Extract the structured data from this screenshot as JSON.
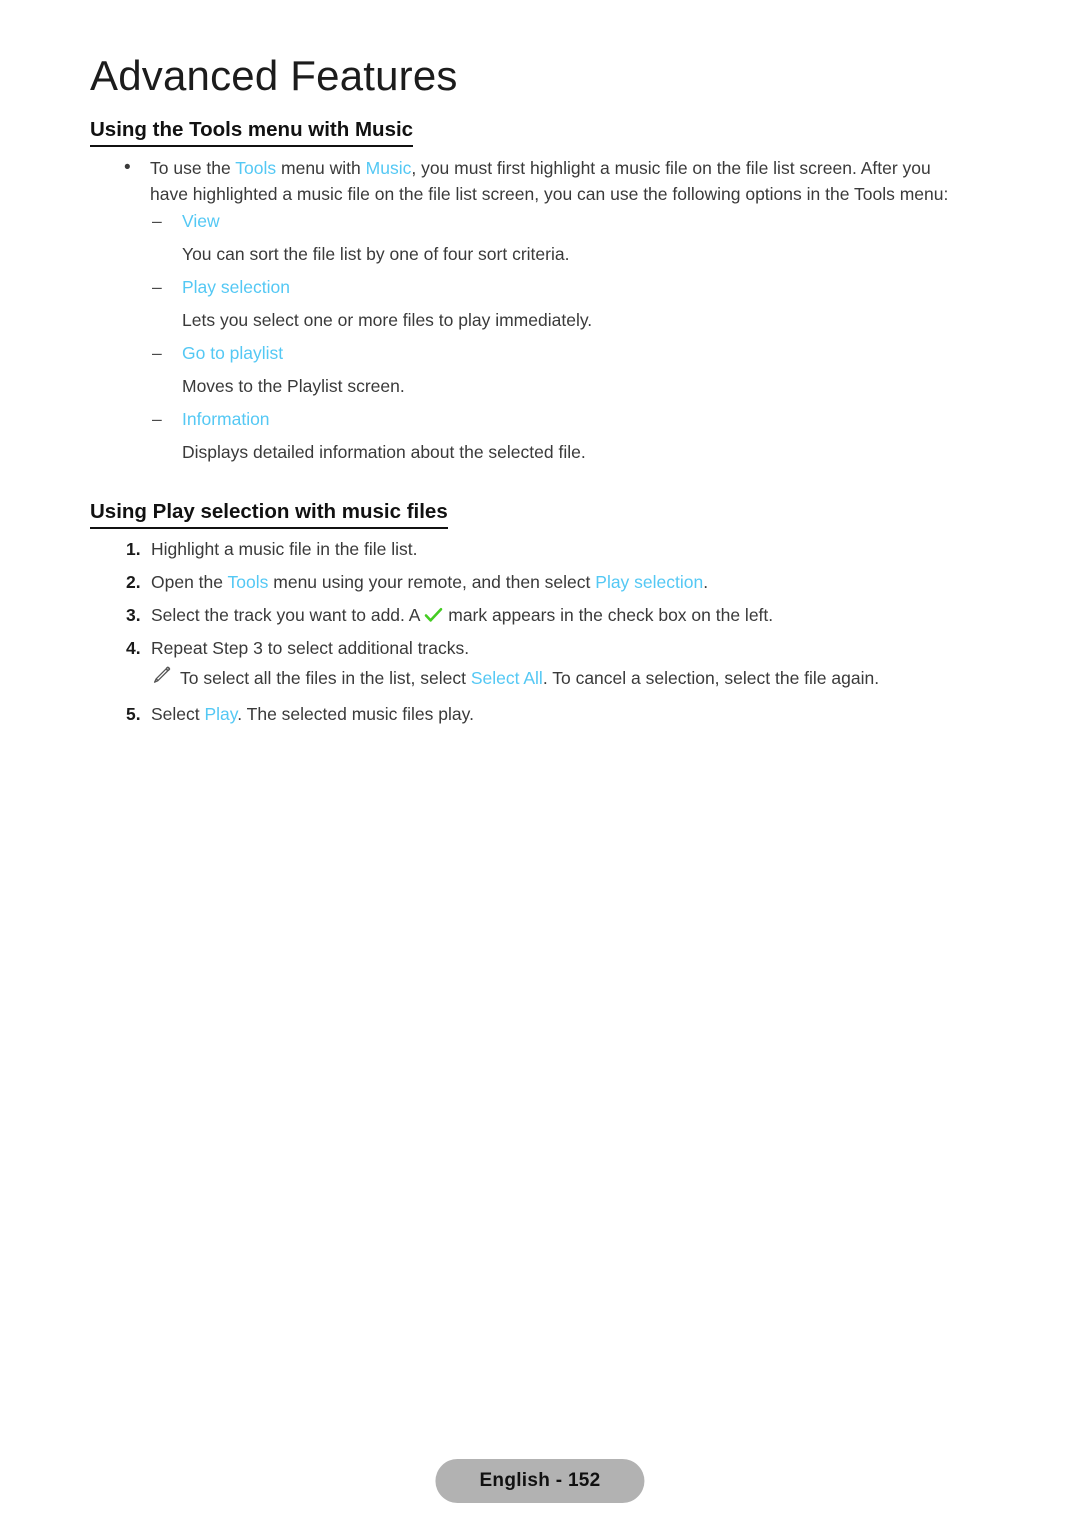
{
  "page": {
    "title": "Advanced Features",
    "footer_label": "English - 152"
  },
  "colors": {
    "accent_cyan": "#54c8f4",
    "check_green": "#44cc22",
    "footer_badge_bg": "#b2b2b2",
    "text": "#3a3a3a"
  },
  "sections": [
    {
      "heading": "Using the Tools menu with Music",
      "bullet_marker": "•",
      "bullet": {
        "p1": "To use the ",
        "term1": "Tools",
        "p2": " menu with ",
        "term2": "Music",
        "p3": ", you must first highlight a music file on the file list screen. After you have highlighted a music file on the file list screen, you can use the following options in the Tools menu:"
      },
      "sub_marker": "–",
      "sub_items": [
        {
          "label": "View",
          "desc": "You can sort the file list by one of four sort criteria."
        },
        {
          "label": "Play selection",
          "desc": "Lets you select one or more files to play immediately."
        },
        {
          "label": "Go to playlist",
          "desc": "Moves to the Playlist screen."
        },
        {
          "label": "Information",
          "desc": "Displays detailed information about the selected file."
        }
      ]
    },
    {
      "heading": "Using Play selection with music files",
      "steps": [
        {
          "num": "1.",
          "text": "Highlight a music file in the file list."
        },
        {
          "num": "2.",
          "pre": "Open the ",
          "term1": "Tools",
          "mid": " menu using your remote, and then select ",
          "term2": "Play selection",
          "post": "."
        },
        {
          "num": "3.",
          "pre": "Select the track you want to add. A ",
          "icon": "check-icon",
          "post": " mark appears in the check box on the left."
        },
        {
          "num": "4.",
          "text": "Repeat Step 3 to select additional tracks."
        },
        {
          "num": "5.",
          "pre": "Select ",
          "term1": "Play",
          "post": ". The selected music files play."
        }
      ],
      "note": {
        "icon": "pencil-icon",
        "pre": "To select all the files in the list, select ",
        "term": "Select All",
        "post": ". To cancel a selection, select the file again."
      }
    }
  ]
}
